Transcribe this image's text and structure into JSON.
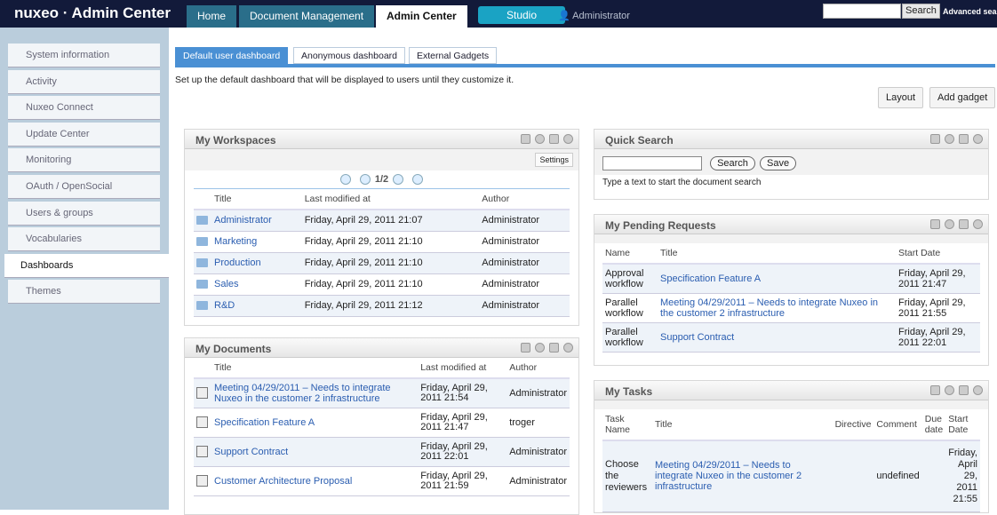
{
  "header": {
    "logo": "nuxeo · Admin Center",
    "tabs": [
      "Home",
      "Document Management",
      "Admin Center",
      "Studio"
    ],
    "user": "Administrator",
    "search_button": "Search",
    "search_value": "",
    "advanced": "Advanced search"
  },
  "sidebar": [
    "System information",
    "Activity",
    "Nuxeo Connect",
    "Update Center",
    "Monitoring",
    "OAuth / OpenSocial",
    "Users & groups",
    "Vocabularies",
    "Dashboards",
    "Themes"
  ],
  "dash_tabs": [
    "Default user dashboard",
    "Anonymous dashboard",
    "External Gadgets"
  ],
  "description": "Set up the default dashboard that will be displayed to users until they customize it.",
  "buttons": {
    "layout": "Layout",
    "add": "Add gadget"
  },
  "workspaces": {
    "title": "My Workspaces",
    "settings": "Settings",
    "page": "1/2",
    "cols": [
      "Title",
      "Last modified at",
      "Author"
    ],
    "rows": [
      [
        "Administrator",
        "Friday, April 29, 2011 21:07",
        "Administrator"
      ],
      [
        "Marketing",
        "Friday, April 29, 2011 21:10",
        "Administrator"
      ],
      [
        "Production",
        "Friday, April 29, 2011 21:10",
        "Administrator"
      ],
      [
        "Sales",
        "Friday, April 29, 2011 21:10",
        "Administrator"
      ],
      [
        "R&D",
        "Friday, April 29, 2011 21:12",
        "Administrator"
      ]
    ]
  },
  "documents": {
    "title": "My Documents",
    "cols": [
      "Title",
      "Last modified at",
      "Author"
    ],
    "rows": [
      [
        "Meeting 04/29/2011 – Needs to integrate Nuxeo in the customer 2 infrastructure",
        "Friday, April 29, 2011 21:54",
        "Administrator"
      ],
      [
        "Specification Feature A",
        "Friday, April 29, 2011 21:47",
        "troger"
      ],
      [
        "Support Contract",
        "Friday, April 29, 2011 22:01",
        "Administrator"
      ],
      [
        "Customer Architecture Proposal",
        "Friday, April 29, 2011 21:59",
        "Administrator"
      ]
    ]
  },
  "quicksearch": {
    "title": "Quick Search",
    "search": "Search",
    "save": "Save",
    "hint": "Type a text to start the document search",
    "value": ""
  },
  "pending": {
    "title": "My Pending Requests",
    "cols": [
      "Name",
      "Title",
      "Start Date"
    ],
    "rows": [
      [
        "Approval workflow",
        "Specification Feature A",
        "Friday, April 29, 2011 21:47"
      ],
      [
        "Parallel workflow",
        "Meeting 04/29/2011 – Needs to integrate Nuxeo in the customer 2 infrastructure",
        "Friday, April 29, 2011 21:55"
      ],
      [
        "Parallel workflow",
        "Support Contract",
        "Friday, April 29, 2011 22:01"
      ]
    ]
  },
  "tasks": {
    "title": "My Tasks",
    "cols": [
      "Task Name",
      "Title",
      "Directive",
      "Comment",
      "Due date",
      "Start Date"
    ],
    "rows": [
      [
        "Choose the reviewers",
        "Meeting 04/29/2011 – Needs to integrate Nuxeo in the customer 2 infrastructure",
        "",
        "undefined",
        "",
        "Friday, April 29, 2011 21:55"
      ]
    ]
  }
}
